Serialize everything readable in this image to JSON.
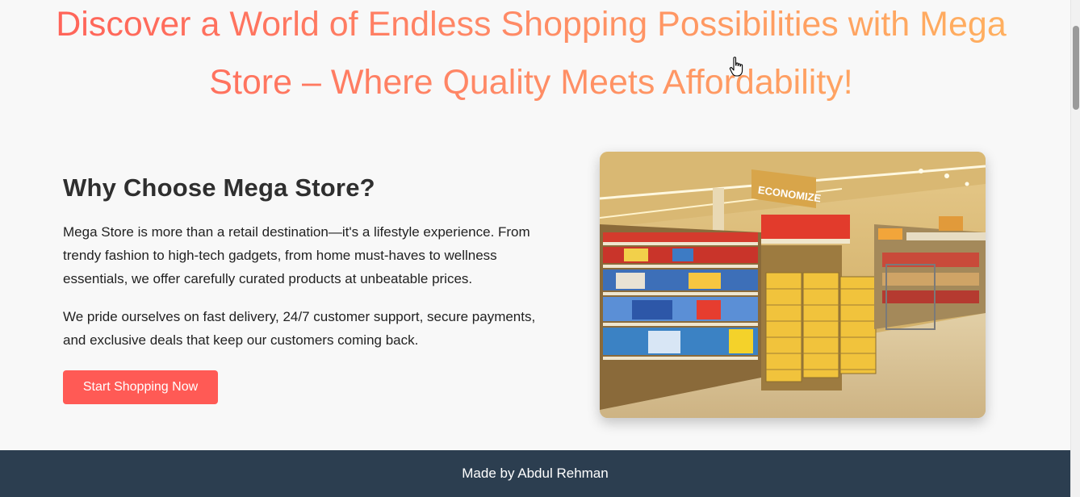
{
  "hero": {
    "title": "Discover a World of Endless Shopping Possibilities with Mega Store – Where Quality Meets Affordability!"
  },
  "about": {
    "heading": "Why Choose Mega Store?",
    "paragraph_1": "Mega Store is more than a retail destination—it's a lifestyle experience. From trendy fashion to high-tech gadgets, from home must-haves to wellness essentials, we offer carefully curated products at unbeatable prices.",
    "paragraph_2": "We pride ourselves on fast delivery, 24/7 customer support, secure payments, and exclusive deals that keep our customers coming back.",
    "cta_label": "Start Shopping Now"
  },
  "photo": {
    "sign_text": "ECONOMIZE"
  },
  "footer": {
    "credit": "Made by Abdul Rehman"
  },
  "colors": {
    "accent": "#ff5a55",
    "gradient_start": "#ff6158",
    "gradient_end": "#ffb25f",
    "footer_bg": "#2c3e50",
    "page_bg": "#f8f8f8"
  }
}
